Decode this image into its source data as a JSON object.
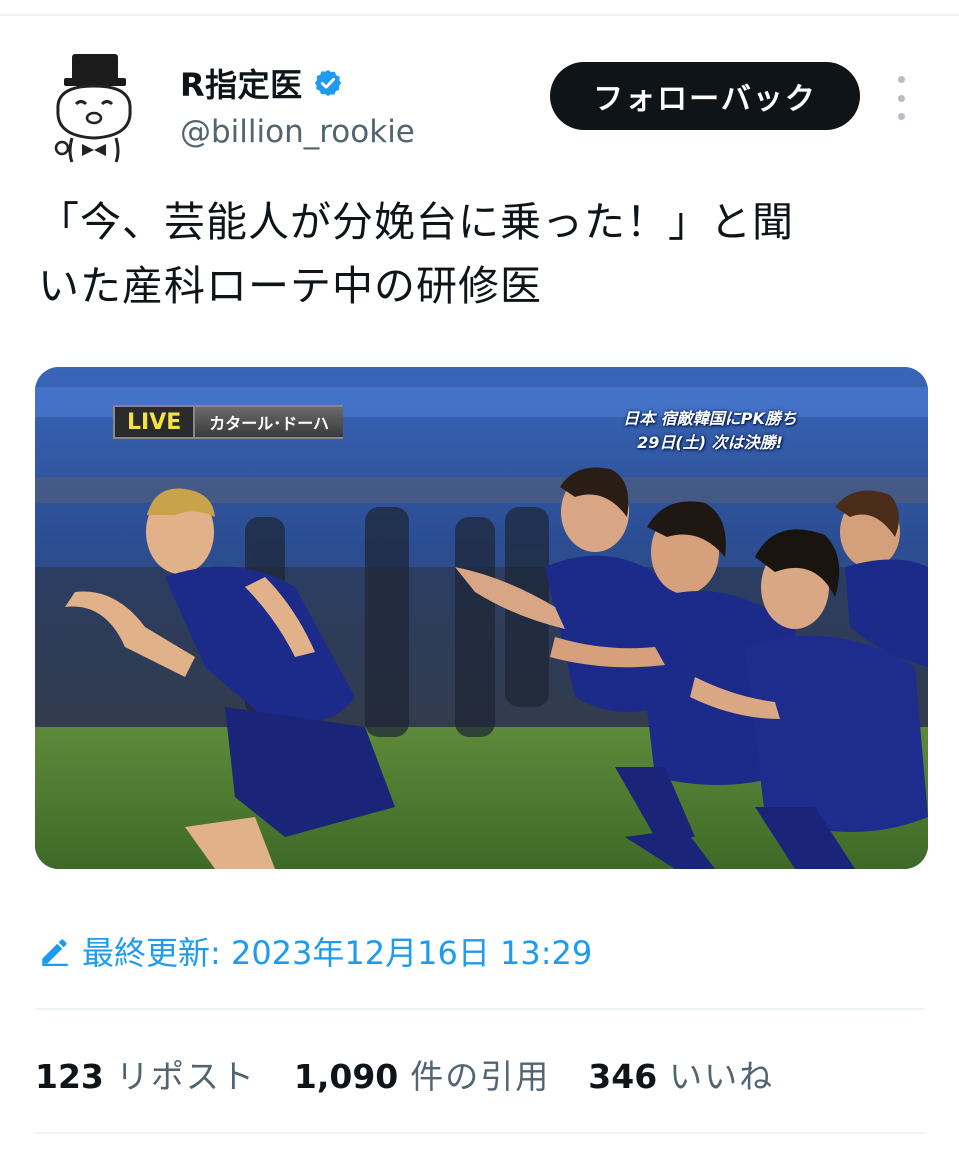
{
  "profile": {
    "display_name": "R指定医",
    "handle": "@billion_rookie",
    "verified_color": "#1d9bf0"
  },
  "actions": {
    "follow_label": "フォローバック"
  },
  "tweet": {
    "text": "「今、芸能人が分娩台に乗った！」と聞\nいた産科ローテ中の研修医"
  },
  "media": {
    "overlay": {
      "live_label": "LIVE",
      "location_label": "カタール･ドーハ",
      "caption_line1": "日本 宿敵韓国にPK勝ち",
      "caption_line2": "29日(土) 次は決勝!"
    }
  },
  "edited": {
    "label": "最終更新: 2023年12月16日 13:29"
  },
  "stats": {
    "reposts_count": "123",
    "reposts_label": "リポスト",
    "quotes_count": "1,090",
    "quotes_label": "件の引用",
    "likes_count": "346",
    "likes_label": "いいね"
  },
  "icons": {
    "verified": "verified-badge-icon",
    "more": "more-vertical-icon",
    "edit": "pencil-icon"
  },
  "colors": {
    "accent": "#1d9bf0",
    "text_primary": "#0f1419",
    "text_secondary": "#536471",
    "button_bg": "#0f1419"
  }
}
